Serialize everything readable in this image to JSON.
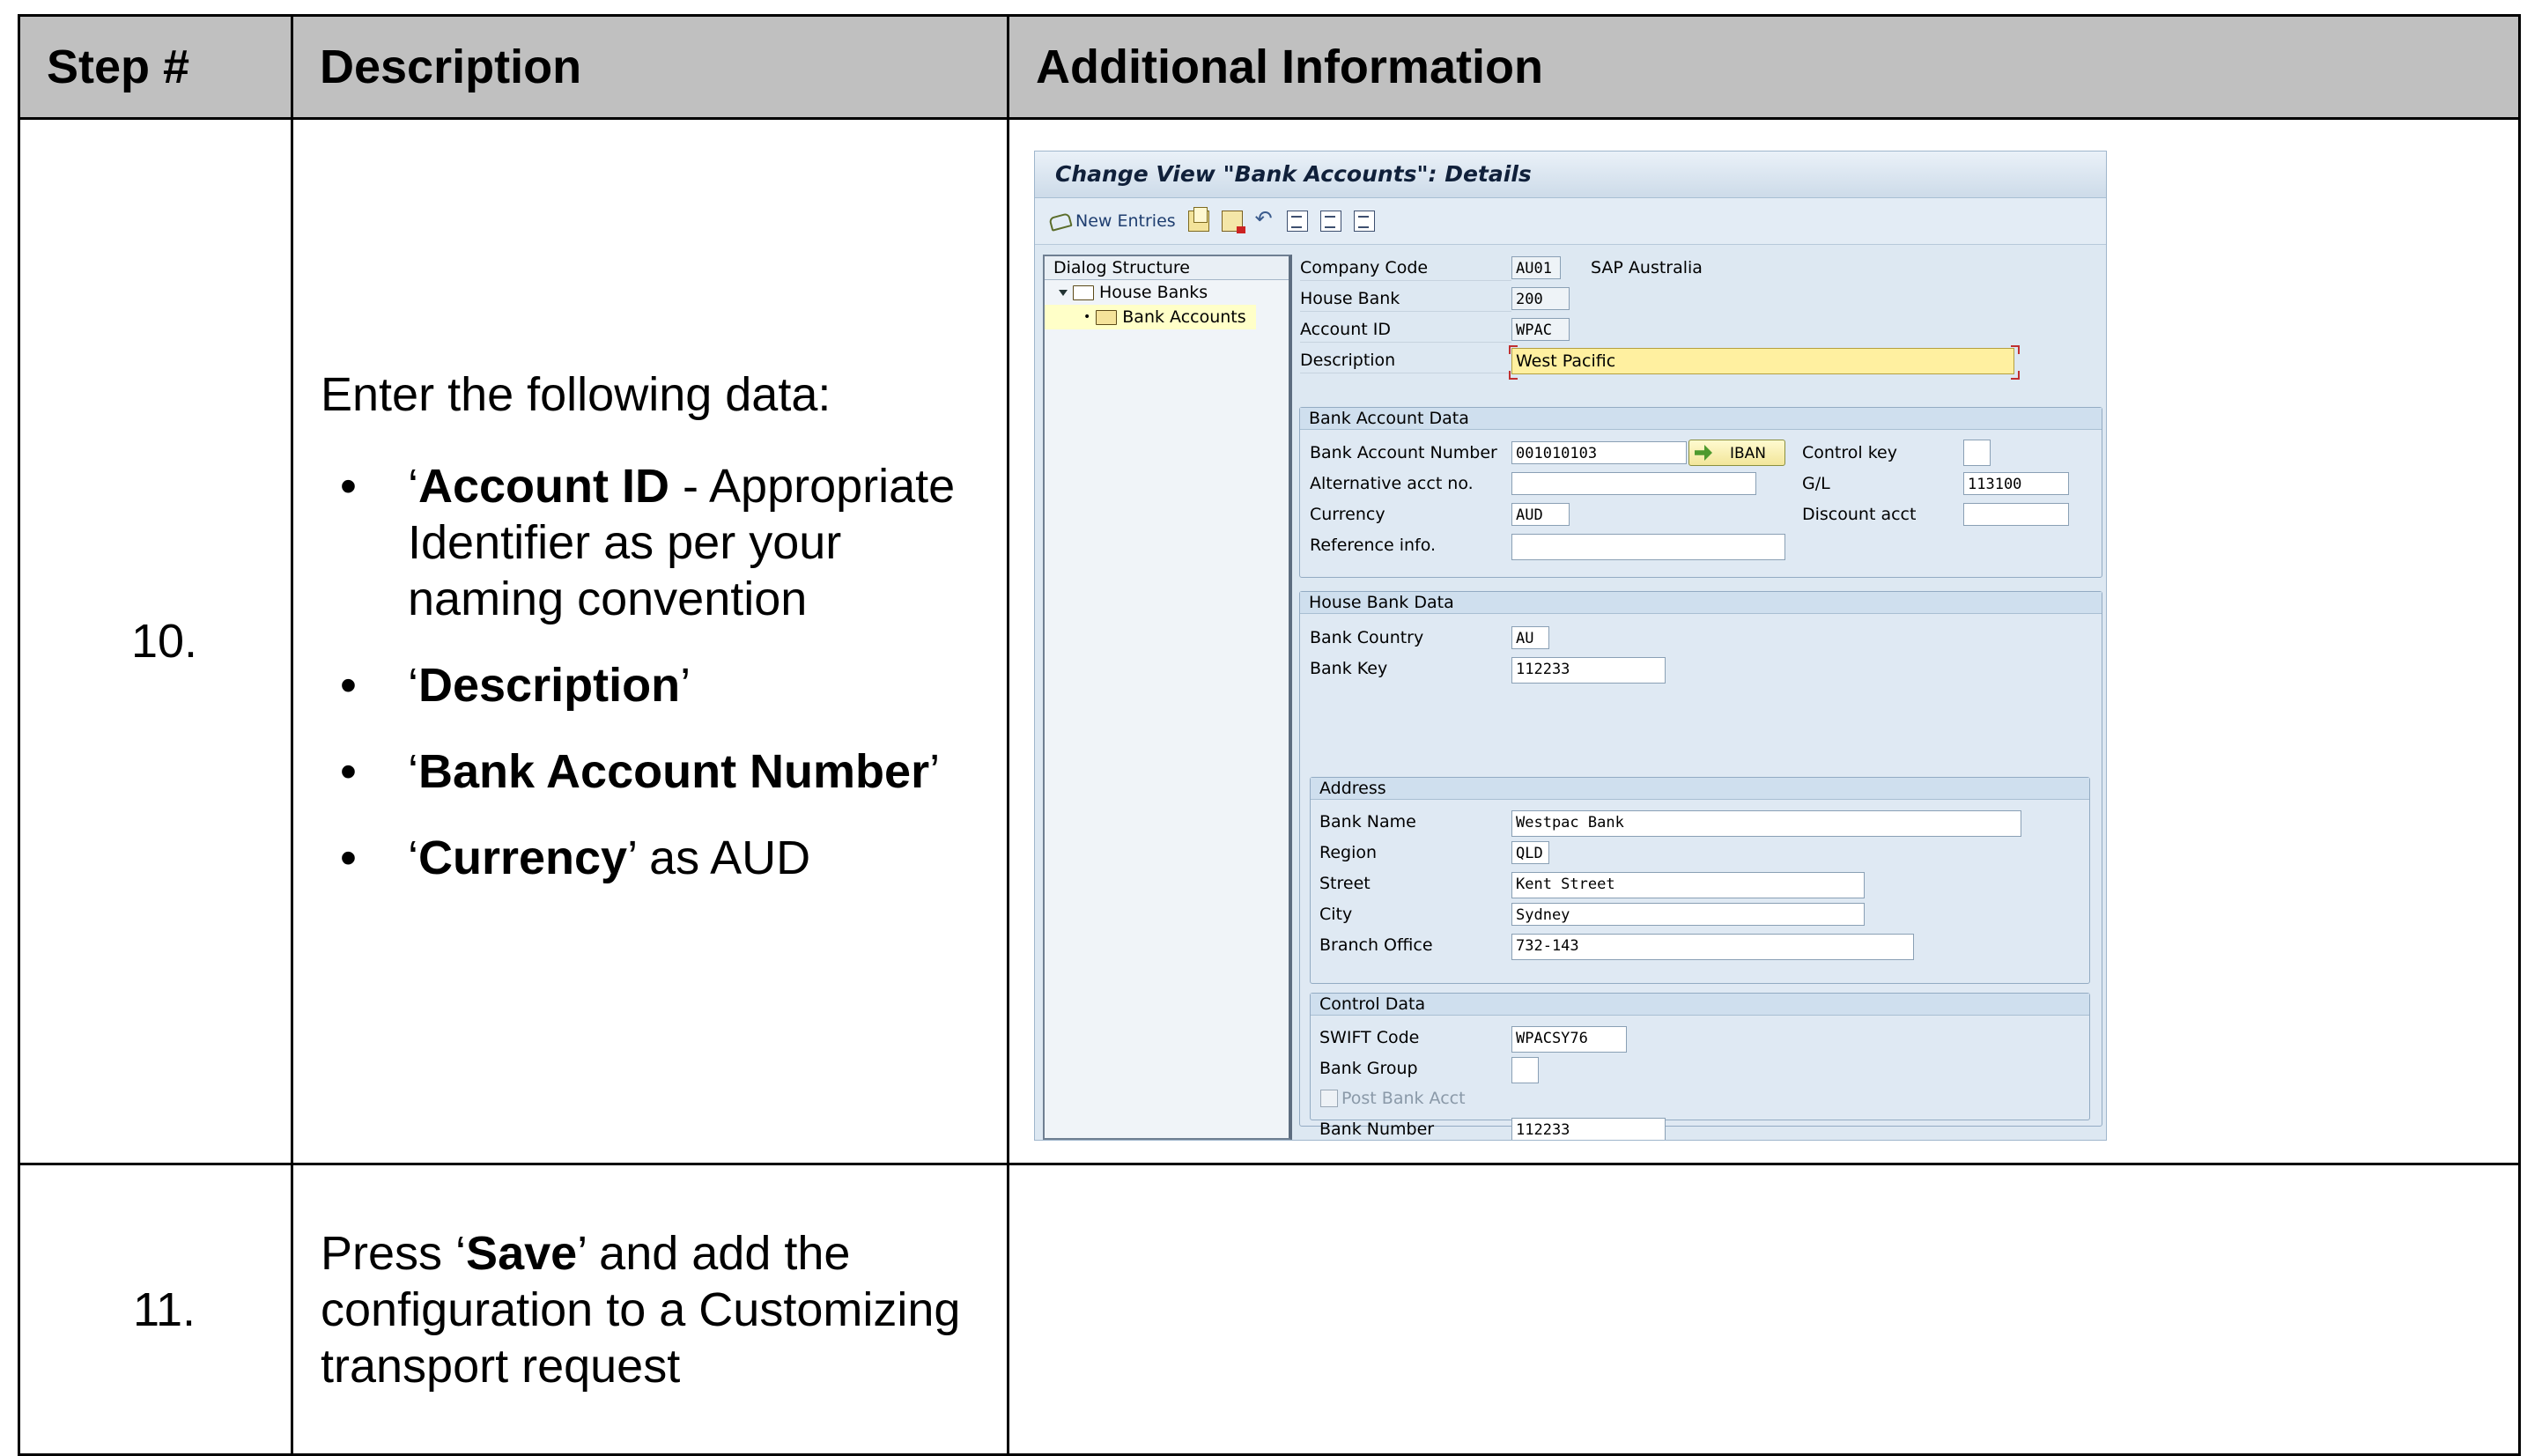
{
  "table": {
    "headers": [
      "Step #",
      "Description",
      "Additional Information"
    ]
  },
  "step10": {
    "number": "10.",
    "intro": "Enter the following data:",
    "bullets": [
      {
        "bold": "Account ID",
        "rest": " - Appropriate Identifier as per your naming convention"
      },
      {
        "bold": "Description",
        "rest": "’"
      },
      {
        "bold": "Bank Account Number",
        "rest": "’"
      },
      {
        "bold": "Currency",
        "rest": "’ as AUD"
      }
    ]
  },
  "step11": {
    "number": "11.",
    "pre": "Press ‘",
    "bold": "Save",
    "post": "’ and add the configuration to a Customizing transport request"
  },
  "sap": {
    "title": "Change View \"Bank Accounts\": Details",
    "toolbar": {
      "new_entries": "New Entries"
    },
    "tree": {
      "header": "Dialog Structure",
      "house_banks": "House Banks",
      "bank_accounts": "Bank Accounts"
    },
    "header_fields": {
      "company_code_label": "Company Code",
      "company_code": "AU01",
      "company_name": "SAP Australia",
      "house_bank_label": "House Bank",
      "house_bank": "200",
      "account_id_label": "Account ID",
      "account_id": "WPAC",
      "description_label": "Description",
      "description": "West Pacific"
    },
    "bank_account_data": {
      "title": "Bank Account Data",
      "account_number_label": "Bank Account Number",
      "account_number": "001010103",
      "iban_button": "IBAN",
      "control_key_label": "Control key",
      "control_key": "",
      "alt_acct_label": "Alternative acct no.",
      "alt_acct": "",
      "gl_label": "G/L",
      "gl": "113100",
      "currency_label": "Currency",
      "currency": "AUD",
      "discount_label": "Discount acct",
      "discount": "",
      "reference_label": "Reference info.",
      "reference": ""
    },
    "house_bank_data": {
      "title": "House Bank Data",
      "country_label": "Bank Country",
      "country": "AU",
      "bank_key_label": "Bank Key",
      "bank_key": "112233"
    },
    "address": {
      "title": "Address",
      "bank_name_label": "Bank Name",
      "bank_name": "Westpac Bank",
      "region_label": "Region",
      "region": "QLD",
      "street_label": "Street",
      "street": "Kent Street",
      "city_label": "City",
      "city": "Sydney",
      "branch_label": "Branch Office",
      "branch": "732-143"
    },
    "control_data": {
      "title": "Control Data",
      "swift_label": "SWIFT Code",
      "swift": "WPACSY76",
      "bank_group_label": "Bank Group",
      "bank_group": "",
      "post_bank_acct_label": "Post Bank Acct",
      "bank_number_label": "Bank Number",
      "bank_number": "112233"
    }
  }
}
